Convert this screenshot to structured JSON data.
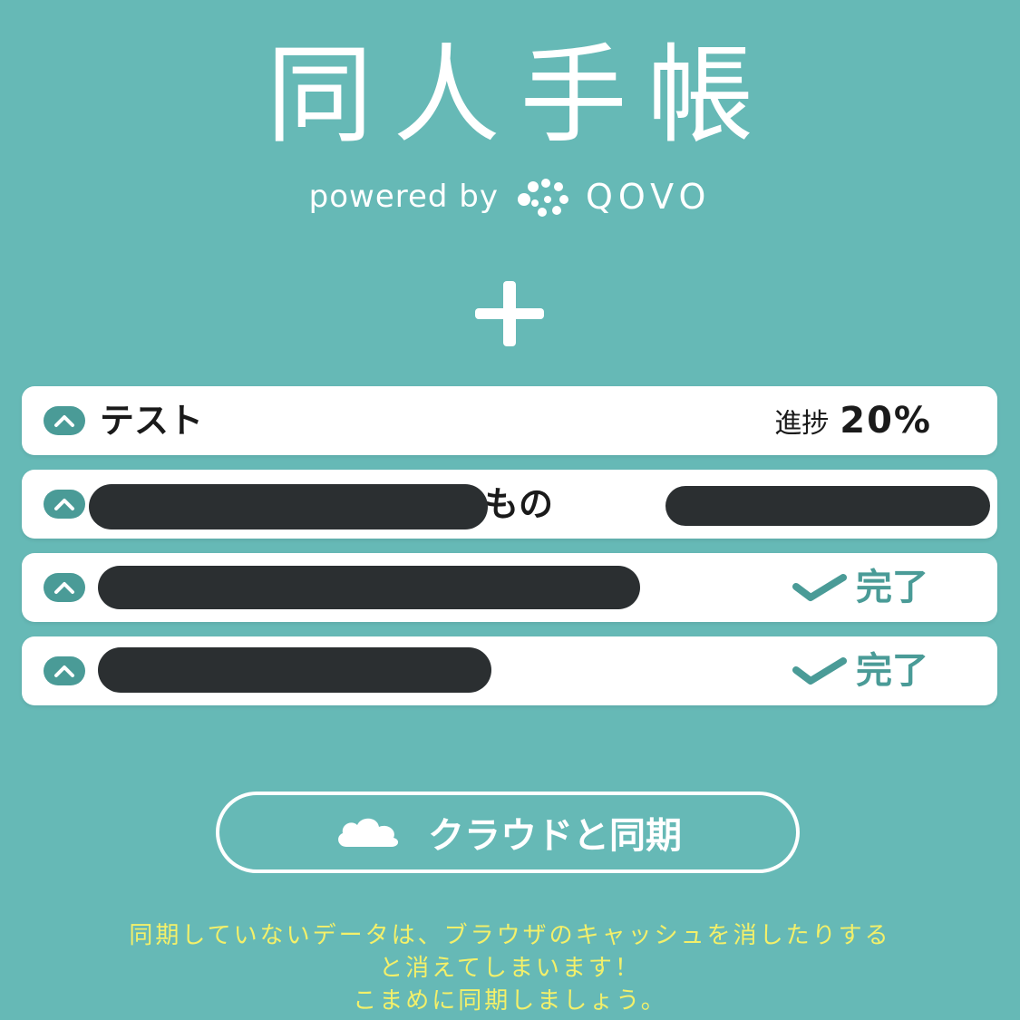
{
  "app": {
    "title": "同人手帳",
    "powered_by": "powered by",
    "brand": "QOVO"
  },
  "colors": {
    "background": "#66b9b6",
    "accent": "#4a9b97",
    "notice_text": "#f3f06a",
    "redaction": "#2b2f31"
  },
  "icons": {
    "add": "plus-icon",
    "expand": "chevron-up-icon",
    "done": "check-icon",
    "cloud": "cloud-icon"
  },
  "projects": [
    {
      "name": "テスト",
      "progress_label": "進捗",
      "progress_value": "20%"
    },
    {
      "name": "もの"
    },
    {
      "status": "完了"
    },
    {
      "status": "完了"
    }
  ],
  "sync": {
    "label": "クラウドと同期"
  },
  "notice": {
    "line1": "同期していないデータは、ブラウザのキャッシュを消したりする",
    "line2": "と消えてしまいます！",
    "line3": "こまめに同期しましょう。"
  }
}
